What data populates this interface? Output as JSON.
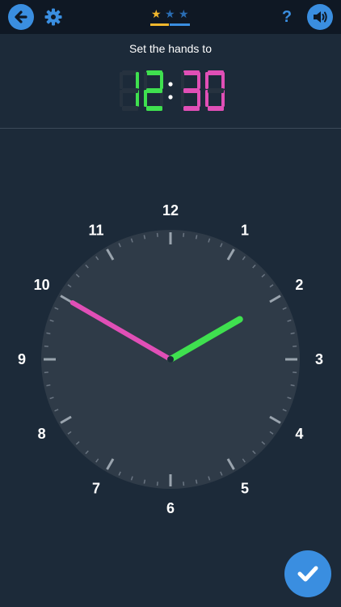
{
  "instruction": "Set the hands to",
  "target_time": {
    "hours": "12",
    "minutes": "30"
  },
  "dial_numbers": [
    "12",
    "1",
    "2",
    "3",
    "4",
    "5",
    "6",
    "7",
    "8",
    "9",
    "10",
    "11"
  ],
  "current_hands": {
    "hour": 2,
    "minute_hour_position": 10
  },
  "progress": {
    "stars_earned": 1,
    "stars_total": 3
  },
  "icons": {
    "back": "arrow-left-icon",
    "settings": "gear-icon",
    "help": "question-mark-icon",
    "sound": "speaker-icon",
    "check": "checkmark-icon"
  },
  "help_label": "?",
  "colors": {
    "accent": "#3a8ee0",
    "hour_hand": "#3fe04f",
    "minute_hand": "#e04fb6",
    "star": "#f2b82d",
    "dial": "#2f3b48"
  }
}
